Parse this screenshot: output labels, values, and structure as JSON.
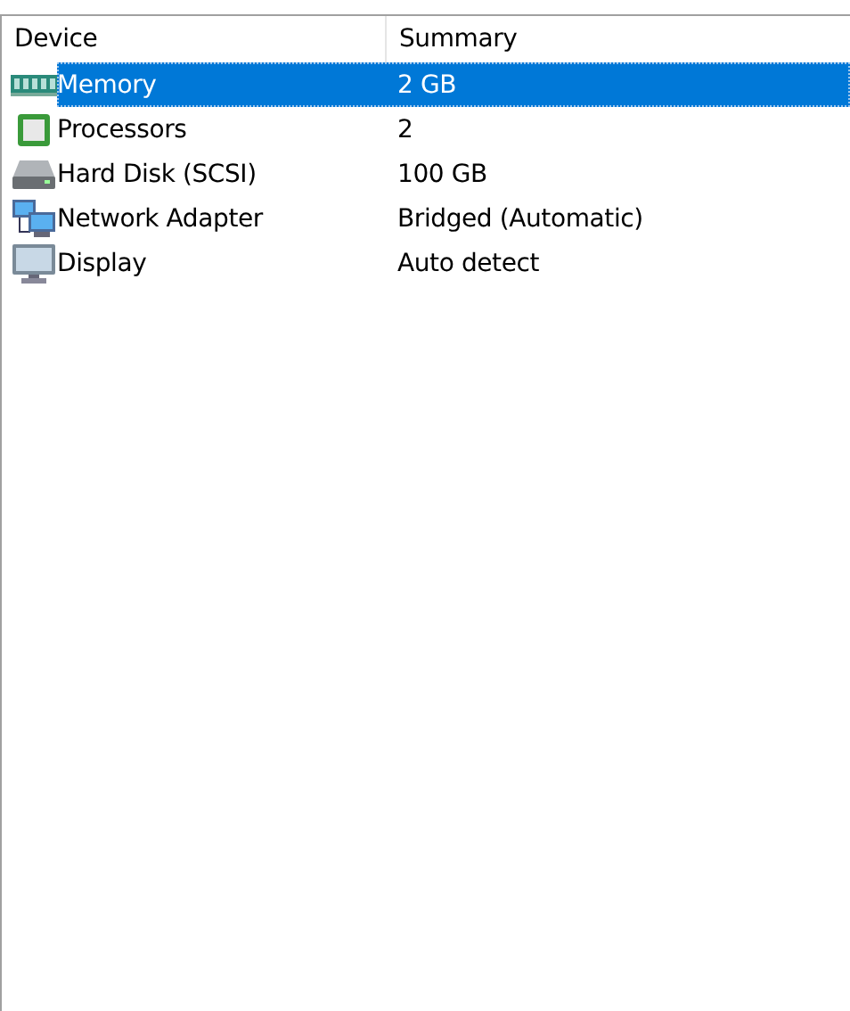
{
  "table": {
    "columns": [
      "Device",
      "Summary"
    ],
    "rows": [
      {
        "kind": "memory",
        "device": "Memory",
        "summary": "2 GB",
        "selected": true
      },
      {
        "kind": "processor",
        "device": "Processors",
        "summary": "2",
        "selected": false
      },
      {
        "kind": "disk",
        "device": "Hard Disk (SCSI)",
        "summary": "100 GB",
        "selected": false
      },
      {
        "kind": "network",
        "device": "Network Adapter",
        "summary": "Bridged (Automatic)",
        "selected": false
      },
      {
        "kind": "display",
        "device": "Display",
        "summary": "Auto detect",
        "selected": false
      }
    ]
  }
}
